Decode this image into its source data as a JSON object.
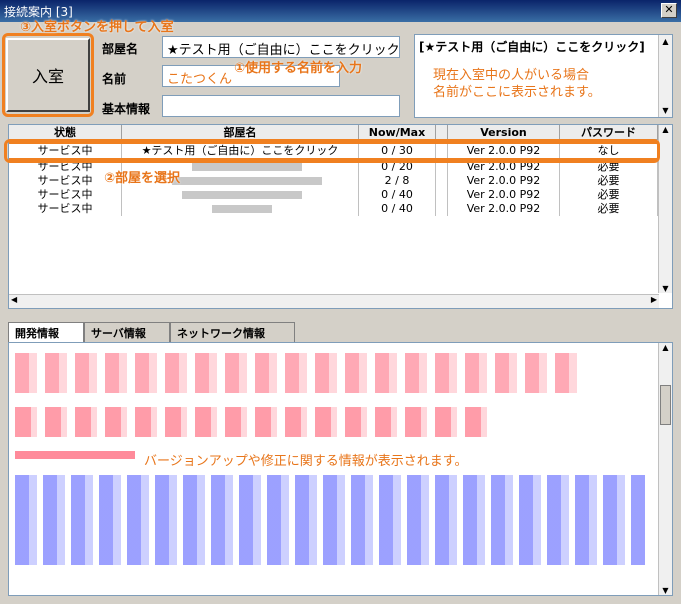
{
  "window": {
    "title": "接続案内 [3]",
    "close_label": "✕"
  },
  "callouts": {
    "step3": "③入室ボタンを押して入室",
    "step1": "①使用する名前を入力",
    "step2": "②部屋を選択"
  },
  "room_form": {
    "enter_label": "入室",
    "room_label": "部屋名",
    "room_value": "★テスト用（ご自由に）ここをクリック",
    "name_label": "名前",
    "name_value": "こたつくん",
    "basic_label": "基本情報",
    "basic_value": ""
  },
  "occupants": {
    "heading": "[★テスト用（ご自由に）ここをクリック]",
    "note": "現在入室中の人がいる場合\n名前がここに表示されます。"
  },
  "room_table": {
    "columns": [
      "状態",
      "部屋名",
      "Now/Max",
      "",
      "Version",
      "パスワード"
    ],
    "rows": [
      {
        "status": "サービス中",
        "name": "★テスト用（ご自由に）ここをクリック",
        "nowmax": "0 / 30",
        "version": "Ver 2.0.0 P92",
        "password": "なし",
        "selected": true
      },
      {
        "status": "サービス中",
        "name": "",
        "nowmax": "0 / 20",
        "version": "Ver 2.0.0 P92",
        "password": "必要"
      },
      {
        "status": "サービス中",
        "name": "",
        "nowmax": "2 / 8",
        "version": "Ver 2.0.0 P92",
        "password": "必要"
      },
      {
        "status": "サービス中",
        "name": "",
        "nowmax": "0 / 40",
        "version": "Ver 2.0.0 P92",
        "password": "必要"
      },
      {
        "status": "サービス中",
        "name": "",
        "nowmax": "0 / 40",
        "version": "Ver 2.0.0 P92",
        "password": "必要"
      }
    ]
  },
  "info_tabs": [
    "開発情報",
    "サーバ情報",
    "ネットワーク情報"
  ],
  "dev_panel": {
    "note": "バージョンアップや修正に関する情報が表示されます。"
  },
  "colors": {
    "accent": "#f08020",
    "callout": "#e8751a",
    "highlight_red": "#ff9aa8",
    "highlight_blue": "#8a90ff"
  }
}
